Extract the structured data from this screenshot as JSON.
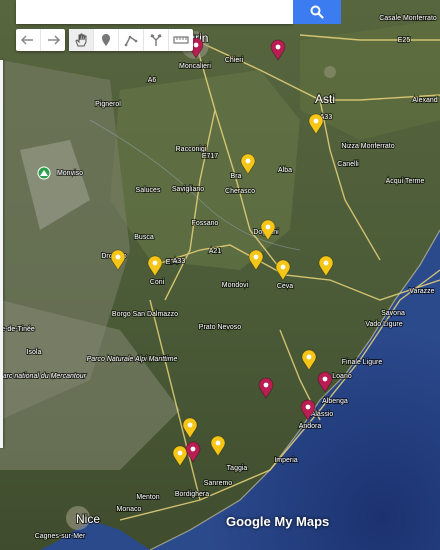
{
  "search": {
    "value": "",
    "placeholder": ""
  },
  "toolbar": {
    "tools": [
      {
        "name": "undo-icon"
      },
      {
        "name": "redo-icon"
      },
      {
        "name": "hand-icon"
      },
      {
        "name": "add-marker-icon"
      },
      {
        "name": "draw-line-icon"
      },
      {
        "name": "directions-icon"
      },
      {
        "name": "ruler-icon"
      }
    ]
  },
  "map": {
    "labels": [
      {
        "text": "Turin"
      },
      {
        "text": "Moncalieri"
      },
      {
        "text": "Chieri"
      },
      {
        "text": "Pignerol"
      },
      {
        "text": "Asti"
      },
      {
        "text": "Casale Monferrato"
      },
      {
        "text": "Alexand"
      },
      {
        "text": "Racconigi"
      },
      {
        "text": "Bra"
      },
      {
        "text": "Alba"
      },
      {
        "text": "Nizza Monferrato"
      },
      {
        "text": "Canelli"
      },
      {
        "text": "Acqui Terme"
      },
      {
        "text": "Monviso"
      },
      {
        "text": "Saluces"
      },
      {
        "text": "Savigliano"
      },
      {
        "text": "Cherasco"
      },
      {
        "text": "Fossano"
      },
      {
        "text": "Dogliani"
      },
      {
        "text": "Busca"
      },
      {
        "text": "Dronero"
      },
      {
        "text": "Coni"
      },
      {
        "text": "Mondovi"
      },
      {
        "text": "Ceva"
      },
      {
        "text": "Borgo San Dalmazzo"
      },
      {
        "text": "Prato Nevoso"
      },
      {
        "text": "Varazze"
      },
      {
        "text": "Savona"
      },
      {
        "text": "Vado Ligure"
      },
      {
        "text": "e-de-Tinée"
      },
      {
        "text": "Isola"
      },
      {
        "text": "Parco Naturale Alpi Marittime"
      },
      {
        "text": "Parc national du Mercantour"
      },
      {
        "text": "Finale Ligure"
      },
      {
        "text": "Loano"
      },
      {
        "text": "Albenga"
      },
      {
        "text": "Alassio"
      },
      {
        "text": "Andora"
      },
      {
        "text": "Imperia"
      },
      {
        "text": "Taggia"
      },
      {
        "text": "Sanremo"
      },
      {
        "text": "Bordighera"
      },
      {
        "text": "Menton"
      },
      {
        "text": "Monaco"
      },
      {
        "text": "Nice"
      },
      {
        "text": "Cagnes-sur-Mer"
      },
      {
        "text": "A6"
      },
      {
        "text": "A33"
      },
      {
        "text": "E717"
      },
      {
        "text": "E25"
      },
      {
        "text": "A21"
      },
      {
        "text": "E74"
      },
      {
        "text": "A33"
      }
    ],
    "markers": [
      {
        "color": "#b81e52"
      },
      {
        "color": "#b81e52"
      },
      {
        "color": "#f5c518"
      },
      {
        "color": "#f5c518"
      },
      {
        "color": "#f5c518"
      },
      {
        "color": "#f5c518"
      },
      {
        "color": "#f5c518"
      },
      {
        "color": "#f5c518"
      },
      {
        "color": "#f5c518"
      },
      {
        "color": "#f5c518"
      },
      {
        "color": "#f5c518"
      },
      {
        "color": "#b81e52"
      },
      {
        "color": "#b81e52"
      },
      {
        "color": "#b81e52"
      },
      {
        "color": "#f5c518"
      },
      {
        "color": "#f5c518"
      },
      {
        "color": "#f5c518"
      },
      {
        "color": "#b81e52"
      }
    ],
    "logo": "Google My Maps"
  }
}
